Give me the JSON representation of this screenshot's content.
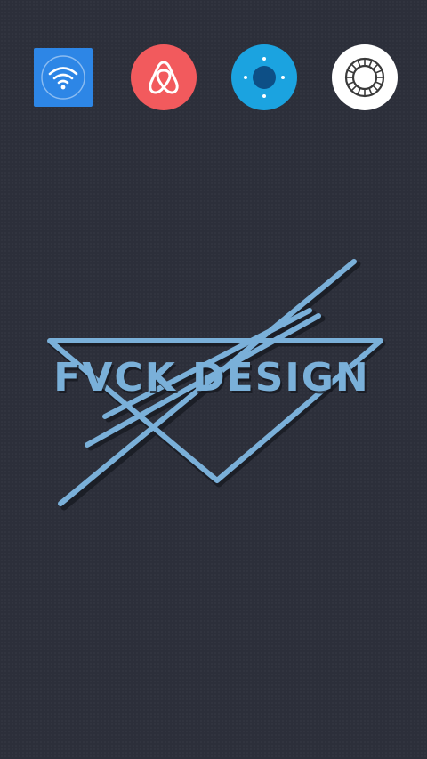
{
  "home": {
    "apps": [
      {
        "icon": "wifi-icon",
        "color": "#2d86e6"
      },
      {
        "icon": "airbnb-icon",
        "color": "#f25a5d"
      },
      {
        "icon": "remote-control-icon",
        "color": "#1ba3e0"
      },
      {
        "icon": "shutter-ring-icon",
        "color": "#ffffff"
      }
    ],
    "wallpaper": {
      "text": "FVCK DESIGN",
      "accent_color": "#7ab0d9",
      "background_color": "#2c2f3a"
    }
  }
}
